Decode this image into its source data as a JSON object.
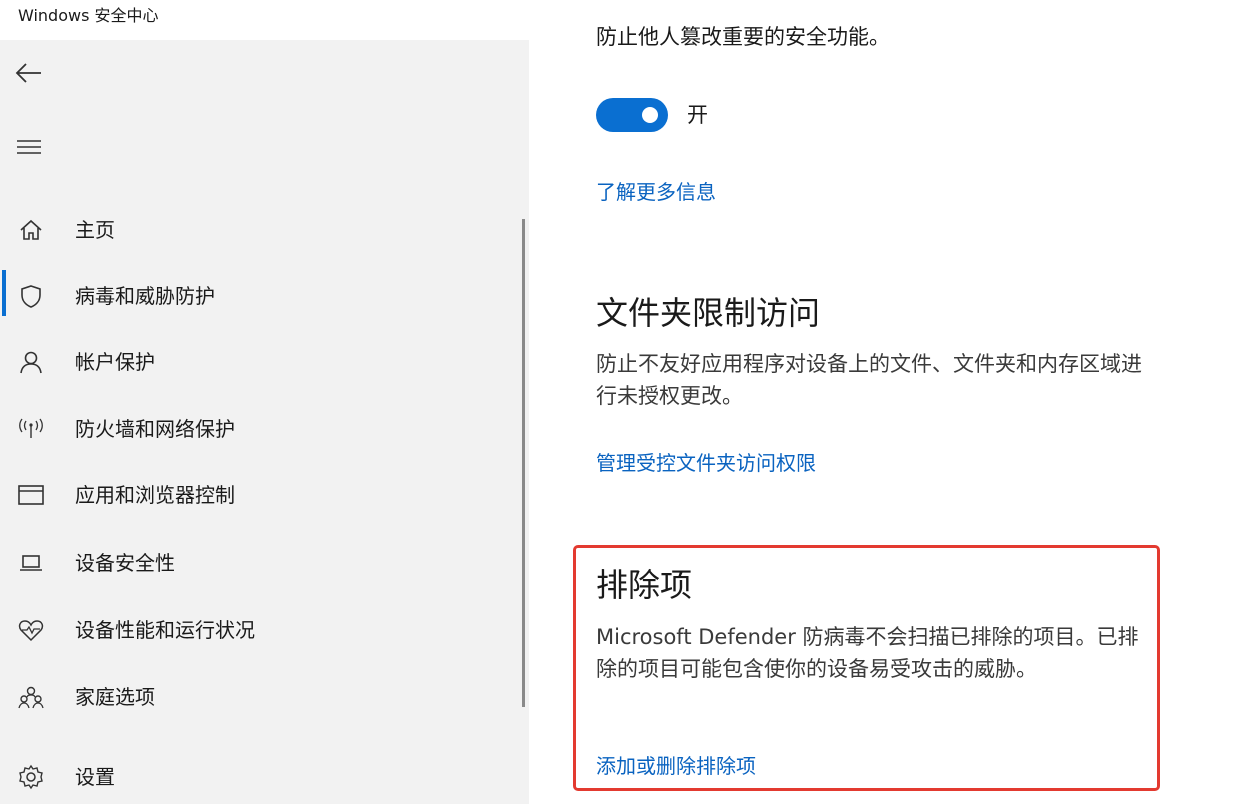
{
  "window": {
    "title": "Windows 安全中心"
  },
  "sidebar": {
    "back_icon": "back-arrow-icon",
    "menu_icon": "hamburger-menu-icon",
    "items": [
      {
        "label": "主页",
        "icon": "home-icon"
      },
      {
        "label": "病毒和威胁防护",
        "icon": "shield-icon",
        "active": true
      },
      {
        "label": "帐户保护",
        "icon": "person-icon"
      },
      {
        "label": "防火墙和网络保护",
        "icon": "wireless-signal-icon"
      },
      {
        "label": "应用和浏览器控制",
        "icon": "browser-window-icon"
      },
      {
        "label": "设备安全性",
        "icon": "laptop-icon"
      },
      {
        "label": "设备性能和运行状况",
        "icon": "heart-pulse-icon"
      },
      {
        "label": "家庭选项",
        "icon": "family-icon"
      },
      {
        "label": "设置",
        "icon": "gear-icon"
      }
    ]
  },
  "main": {
    "cut_off_text": "防止他人篡改重要的安全功能。",
    "toggle": {
      "state_label": "开",
      "on": true,
      "accent": "#0a6fd1"
    },
    "learn_more_link": "了解更多信息",
    "sections": [
      {
        "title": "文件夹限制访问",
        "description": "防止不友好应用程序对设备上的文件、文件夹和内存区域进行未授权更改。",
        "link": "管理受控文件夹访问权限"
      },
      {
        "title": "排除项",
        "description": "Microsoft Defender 防病毒不会扫描已排除的项目。已排除的项目可能包含使你的设备易受攻击的威胁。",
        "link": "添加或删除排除项",
        "highlighted": true,
        "highlight_color": "#e33a30"
      }
    ]
  }
}
